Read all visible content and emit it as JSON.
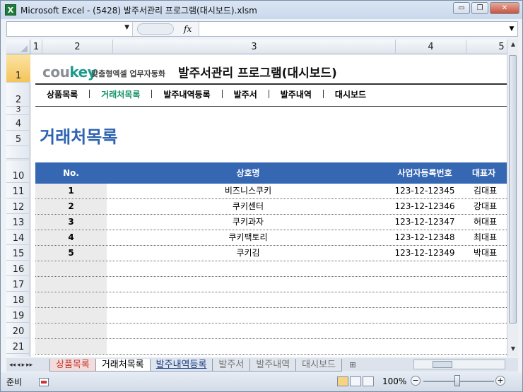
{
  "window": {
    "title": "Microsoft Excel - (5428) 발주서관리 프로그램(대시보드).xlsm",
    "app_icon_text": "X",
    "min_icon": "▭",
    "restore_icon": "❐",
    "close_icon": "✕"
  },
  "formula_bar": {
    "name_box_value": "",
    "fx_label": "fx",
    "formula_value": ""
  },
  "columns": [
    "1",
    "2",
    "3",
    "4",
    "5"
  ],
  "rows": [
    "1",
    "2",
    "3",
    "4",
    "5",
    "10",
    "11",
    "12",
    "13",
    "14",
    "15",
    "16",
    "17",
    "18",
    "19",
    "20",
    "21"
  ],
  "header": {
    "logo_cou": "cou",
    "logo_key": "key",
    "logo_sub": "맞춤형엑셀 업무자동화",
    "title": "발주서관리 프로그램(대시보드)"
  },
  "nav": {
    "items": [
      "상품목록",
      "거래처목록",
      "발주내역등록",
      "발주서",
      "발주내역",
      "대시보드"
    ],
    "active_index": 1,
    "active_color": "#15956b"
  },
  "page_title": "거래처목록",
  "table": {
    "headers": [
      "No.",
      "상호명",
      "사업자등록번호",
      "대표자"
    ],
    "header_bg": "#3667b2",
    "rows": [
      {
        "no": "1",
        "name": "비즈니스쿠키",
        "reg": "123-12-12345",
        "rep": "김대표"
      },
      {
        "no": "2",
        "name": "쿠키센터",
        "reg": "123-12-12346",
        "rep": "강대표"
      },
      {
        "no": "3",
        "name": "쿠키과자",
        "reg": "123-12-12347",
        "rep": "허대표"
      },
      {
        "no": "4",
        "name": "쿠키팩토리",
        "reg": "123-12-12348",
        "rep": "최대표"
      },
      {
        "no": "5",
        "name": "쿠키김",
        "reg": "123-12-12349",
        "rep": "박대표"
      },
      {
        "no": "",
        "name": "",
        "reg": "",
        "rep": ""
      },
      {
        "no": "",
        "name": "",
        "reg": "",
        "rep": ""
      },
      {
        "no": "",
        "name": "",
        "reg": "",
        "rep": ""
      },
      {
        "no": "",
        "name": "",
        "reg": "",
        "rep": ""
      },
      {
        "no": "",
        "name": "",
        "reg": "",
        "rep": ""
      },
      {
        "no": "",
        "name": "",
        "reg": "",
        "rep": ""
      }
    ]
  },
  "sheet_tabs": {
    "nav": [
      "◂◂",
      "◂",
      "▸",
      "▸▸"
    ],
    "tabs": [
      "상품목록",
      "거래처목록",
      "발주내역등록",
      "발주서",
      "발주내역",
      "대시보드"
    ],
    "active_index": 1
  },
  "status": {
    "ready": "준비",
    "zoom": "100%",
    "zoom_minus": "−",
    "zoom_plus": "+"
  }
}
